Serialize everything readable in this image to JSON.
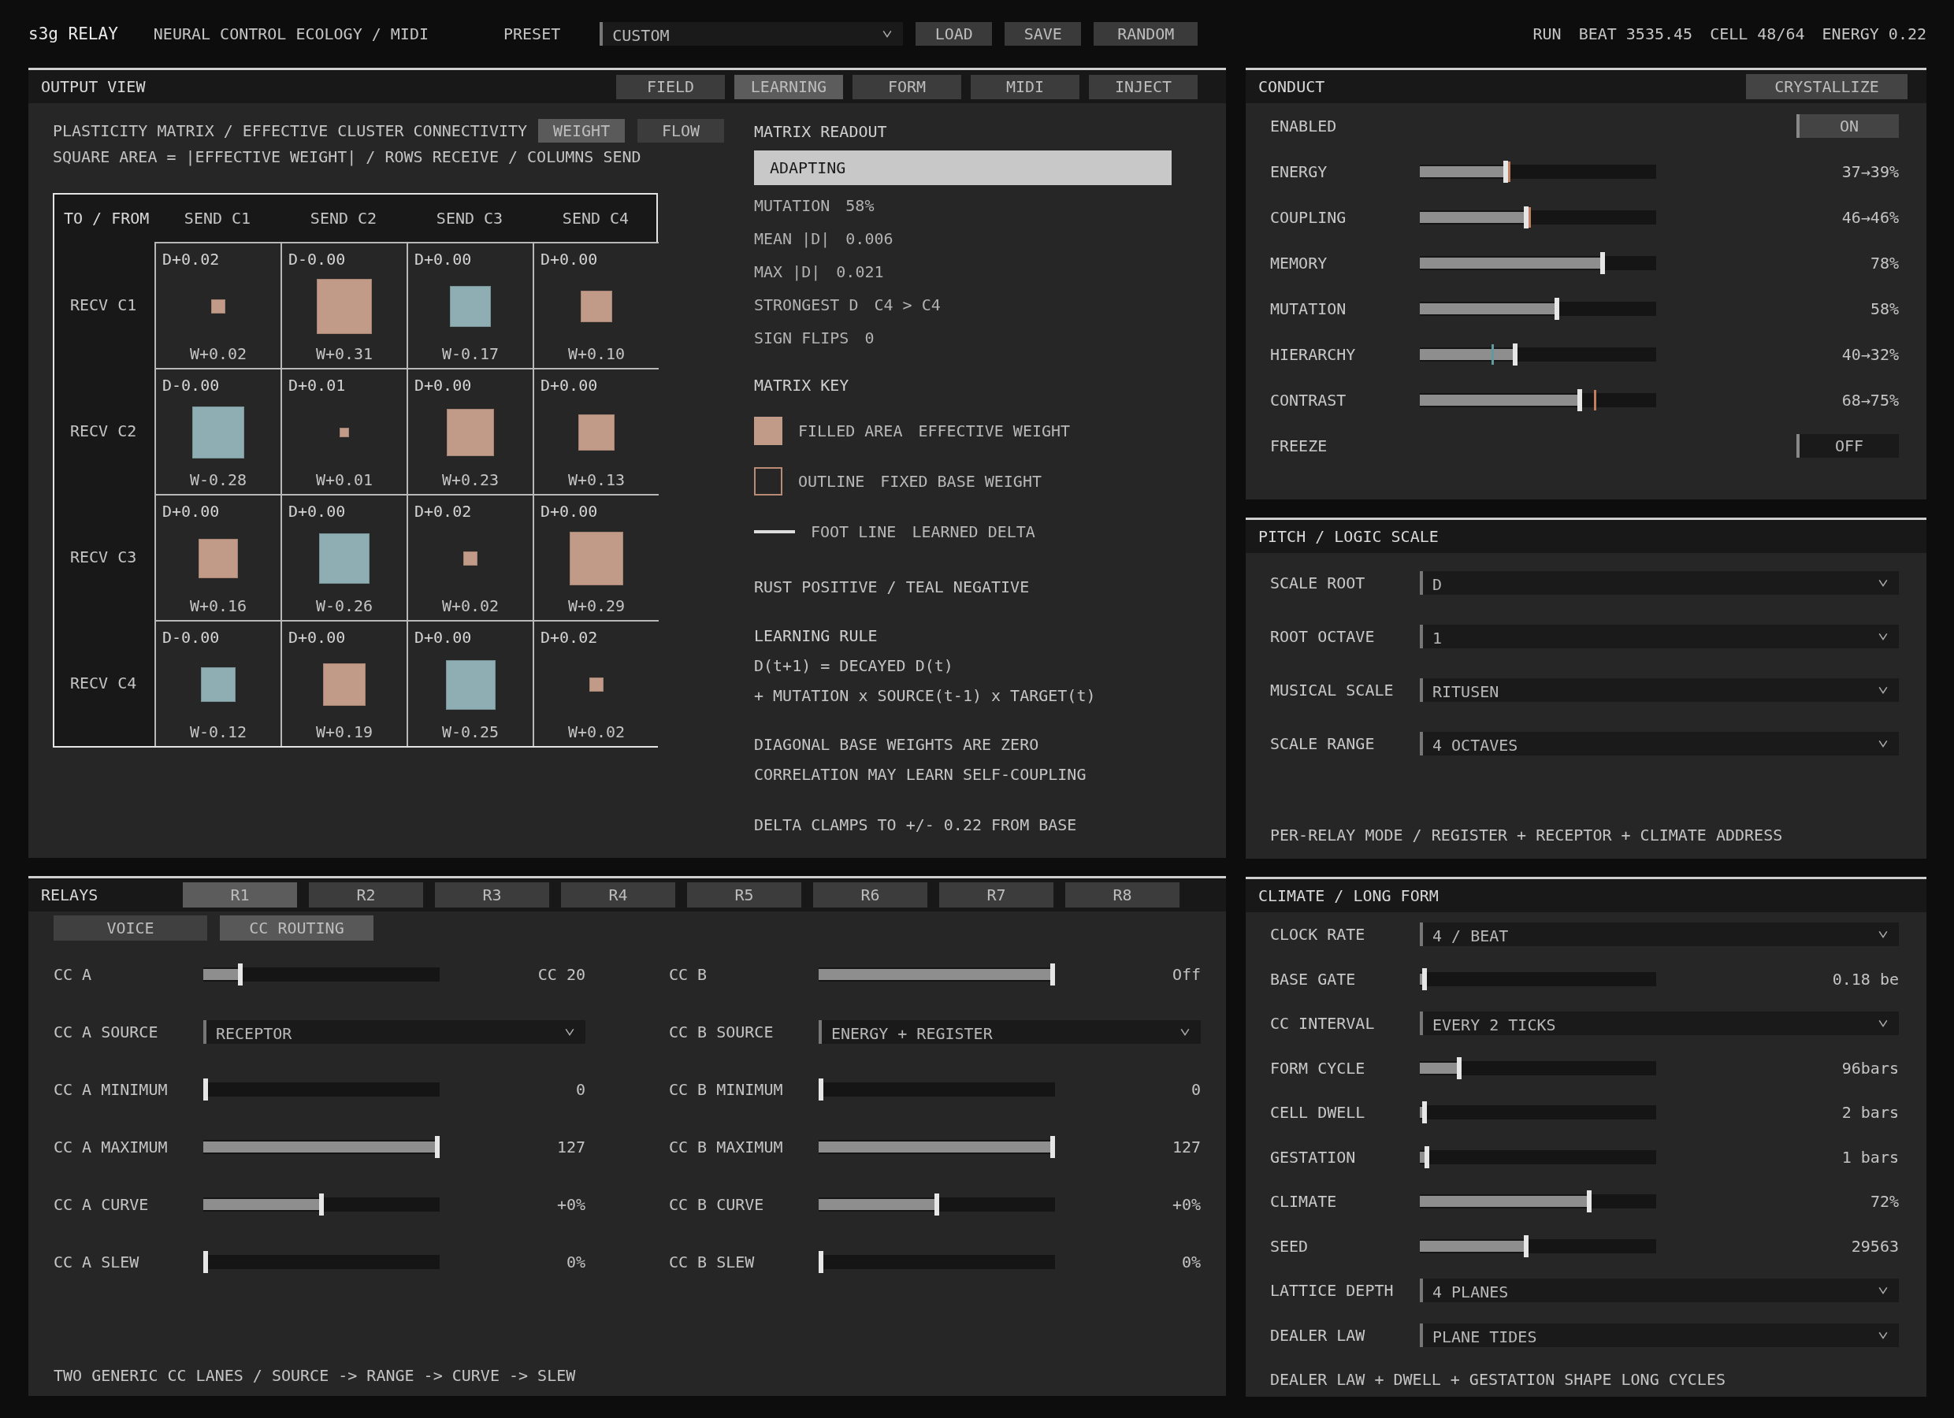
{
  "top_bar": {
    "title": "s3g RELAY",
    "subtitle": "NEURAL CONTROL ECOLOGY / MIDI",
    "preset_label": "PRESET",
    "preset": "CUSTOM",
    "buttons": [
      "LOAD",
      "SAVE",
      "RANDOM"
    ],
    "status": [
      "RUN",
      "BEAT 3535.45",
      "CELL 48/64",
      "ENERGY 0.22"
    ]
  },
  "output_view": {
    "title": "OUTPUT VIEW",
    "tabs": [
      {
        "label": "FIELD",
        "selected": false
      },
      {
        "label": "LEARNING",
        "selected": true
      },
      {
        "label": "FORM",
        "selected": false
      },
      {
        "label": "MIDI",
        "selected": false
      },
      {
        "label": "INJECT",
        "selected": false
      }
    ],
    "heading": "PLASTICITY MATRIX / EFFECTIVE CLUSTER CONNECTIVITY",
    "caption": "SQUARE AREA = |EFFECTIVE WEIGHT| / ROWS RECEIVE / COLUMNS SEND",
    "modes": [
      {
        "label": "WEIGHT",
        "selected": true
      },
      {
        "label": "FLOW",
        "selected": false
      }
    ],
    "matrix": {
      "corner": "TO / FROM",
      "columns": [
        "SEND C1",
        "SEND C2",
        "SEND C3",
        "SEND C4"
      ],
      "rows": [
        {
          "label": "RECV C1",
          "cells": [
            {
              "delta": "D+0.02",
              "weight": "W+0.02",
              "color": "#c29a88"
            },
            {
              "delta": "D-0.00",
              "weight": "W+0.31",
              "color": "#c29a88"
            },
            {
              "delta": "D+0.00",
              "weight": "W-0.17",
              "color": "#8eaeb3"
            },
            {
              "delta": "D+0.00",
              "weight": "W+0.10",
              "color": "#c29a88"
            }
          ]
        },
        {
          "label": "RECV C2",
          "cells": [
            {
              "delta": "D-0.00",
              "weight": "W-0.28",
              "color": "#8eaeb3"
            },
            {
              "delta": "D+0.01",
              "weight": "W+0.01",
              "color": "#c29a88"
            },
            {
              "delta": "D+0.00",
              "weight": "W+0.23",
              "color": "#c29a88"
            },
            {
              "delta": "D+0.00",
              "weight": "W+0.13",
              "color": "#c29a88"
            }
          ]
        },
        {
          "label": "RECV C3",
          "cells": [
            {
              "delta": "D+0.00",
              "weight": "W+0.16",
              "color": "#c29a88"
            },
            {
              "delta": "D+0.00",
              "weight": "W-0.26",
              "color": "#8eaeb3"
            },
            {
              "delta": "D+0.02",
              "weight": "W+0.02",
              "color": "#c29a88"
            },
            {
              "delta": "D+0.00",
              "weight": "W+0.29",
              "color": "#c29a88"
            }
          ]
        },
        {
          "label": "RECV C4",
          "cells": [
            {
              "delta": "D-0.00",
              "weight": "W-0.12",
              "color": "#8eaeb3"
            },
            {
              "delta": "D+0.00",
              "weight": "W+0.19",
              "color": "#c29a88"
            },
            {
              "delta": "D+0.00",
              "weight": "W-0.25",
              "color": "#8eaeb3"
            },
            {
              "delta": "D+0.02",
              "weight": "W+0.02",
              "color": "#c29a88"
            }
          ]
        }
      ]
    },
    "readout": {
      "title": "MATRIX READOUT",
      "state": "ADAPTING",
      "stats": [
        {
          "label": "MUTATION",
          "value": "58%"
        },
        {
          "label": "MEAN |D|",
          "value": "0.006"
        },
        {
          "label": "MAX |D|",
          "value": "0.021"
        },
        {
          "label": "STRONGEST D",
          "value": "C4 > C4"
        },
        {
          "label": "SIGN FLIPS",
          "value": "0"
        }
      ],
      "key_title": "MATRIX KEY",
      "key": [
        {
          "kind": "filled",
          "name": "FILLED AREA",
          "meaning": "EFFECTIVE WEIGHT"
        },
        {
          "kind": "outline",
          "name": "OUTLINE",
          "meaning": "FIXED BASE WEIGHT"
        },
        {
          "kind": "line",
          "name": "FOOT LINE",
          "meaning": "LEARNED DELTA"
        }
      ],
      "sign_note": "RUST POSITIVE / TEAL NEGATIVE",
      "rule_title": "LEARNING RULE",
      "rule": [
        "D(t+1) = DECAYED D(t)",
        "+ MUTATION x SOURCE(t-1) x TARGET(t)"
      ],
      "notes": [
        "DIAGONAL BASE WEIGHTS ARE ZERO",
        "CORRELATION MAY LEARN SELF-COUPLING"
      ],
      "clamp_note": "DELTA CLAMPS TO +/- 0.22 FROM BASE"
    }
  },
  "relays": {
    "title": "RELAYS",
    "tabs": [
      {
        "label": "R1",
        "selected": true
      },
      {
        "label": "R2",
        "selected": false
      },
      {
        "label": "R3",
        "selected": false
      },
      {
        "label": "R4",
        "selected": false
      },
      {
        "label": "R5",
        "selected": false
      },
      {
        "label": "R6",
        "selected": false
      },
      {
        "label": "R7",
        "selected": false
      },
      {
        "label": "R8",
        "selected": false
      }
    ],
    "views": [
      {
        "label": "VOICE",
        "selected": false
      },
      {
        "label": "CC ROUTING",
        "selected": true
      }
    ],
    "lanes": [
      [
        {
          "kind": "slider",
          "label": "CC A",
          "level": 0.15,
          "value": "CC 20"
        },
        {
          "kind": "select",
          "label": "CC A SOURCE",
          "value": "RECEPTOR"
        },
        {
          "kind": "slider",
          "label": "CC A MINIMUM",
          "level": 0,
          "value": "0"
        },
        {
          "kind": "slider",
          "label": "CC A MAXIMUM",
          "level": 1,
          "value": "127"
        },
        {
          "kind": "slider",
          "label": "CC A CURVE",
          "level": 0.5,
          "value": "+0%"
        },
        {
          "kind": "slider",
          "label": "CC A SLEW",
          "level": 0,
          "value": "0%"
        }
      ],
      [
        {
          "kind": "slider",
          "label": "CC B",
          "level": 1,
          "value": "Off"
        },
        {
          "kind": "select",
          "label": "CC B SOURCE",
          "value": "ENERGY + REGISTER"
        },
        {
          "kind": "slider",
          "label": "CC B MINIMUM",
          "level": 0,
          "value": "0"
        },
        {
          "kind": "slider",
          "label": "CC B MAXIMUM",
          "level": 1,
          "value": "127"
        },
        {
          "kind": "slider",
          "label": "CC B CURVE",
          "level": 0.5,
          "value": "+0%"
        },
        {
          "kind": "slider",
          "label": "CC B SLEW",
          "level": 0,
          "value": "0%"
        }
      ]
    ],
    "footer": "TWO GENERIC CC LANES / SOURCE -> RANGE -> CURVE -> SLEW"
  },
  "conduct": {
    "title": "CONDUCT",
    "action": "CRYSTALLIZE",
    "rows": [
      {
        "kind": "toggle",
        "label": "ENABLED",
        "on": true,
        "value": "ON"
      },
      {
        "kind": "slider",
        "label": "ENERGY",
        "level": 0.36,
        "target": {
          "level": 0.38,
          "color": "#c0805e"
        },
        "value": "37→39%"
      },
      {
        "kind": "slider",
        "label": "COUPLING",
        "level": 0.45,
        "target": {
          "level": 0.47,
          "color": "#c0805e"
        },
        "value": "46→46%"
      },
      {
        "kind": "slider",
        "label": "MEMORY",
        "level": 0.78,
        "value": "78%"
      },
      {
        "kind": "slider",
        "label": "MUTATION",
        "level": 0.58,
        "value": "58%"
      },
      {
        "kind": "slider",
        "label": "HIERARCHY",
        "level": 0.4,
        "target": {
          "level": 0.31,
          "color": "#5f9aa0"
        },
        "value": "40→32%"
      },
      {
        "kind": "slider",
        "label": "CONTRAST",
        "level": 0.68,
        "target": {
          "level": 0.75,
          "color": "#c0805e"
        },
        "value": "68→75%"
      },
      {
        "kind": "toggle",
        "label": "FREEZE",
        "on": false,
        "value": "OFF"
      }
    ]
  },
  "pitch": {
    "title": "PITCH / LOGIC SCALE",
    "rows": [
      {
        "label": "SCALE ROOT",
        "value": "D"
      },
      {
        "label": "ROOT OCTAVE",
        "value": "1"
      },
      {
        "label": "MUSICAL SCALE",
        "value": "RITUSEN"
      },
      {
        "label": "SCALE RANGE",
        "value": "4 OCTAVES"
      }
    ],
    "footer": "PER-RELAY MODE / REGISTER + RECEPTOR + CLIMATE ADDRESS"
  },
  "climate": {
    "title": "CLIMATE / LONG FORM",
    "rows": [
      {
        "kind": "select",
        "label": "CLOCK RATE",
        "value": "4 / BEAT"
      },
      {
        "kind": "slider",
        "label": "BASE GATE",
        "level": 0.01,
        "value": "0.18 be"
      },
      {
        "kind": "select",
        "label": "CC INTERVAL",
        "value": "EVERY 2 TICKS"
      },
      {
        "kind": "slider",
        "label": "FORM CYCLE",
        "level": 0.16,
        "value": "96bars"
      },
      {
        "kind": "slider",
        "label": "CELL DWELL",
        "level": 0.01,
        "value": "2 bars"
      },
      {
        "kind": "slider",
        "label": "GESTATION",
        "level": 0.02,
        "value": "1 bars"
      },
      {
        "kind": "slider",
        "label": "CLIMATE",
        "level": 0.72,
        "value": "72%"
      },
      {
        "kind": "slider",
        "label": "SEED",
        "level": 0.45,
        "value": "29563"
      },
      {
        "kind": "select",
        "label": "LATTICE DEPTH",
        "value": "4 PLANES"
      },
      {
        "kind": "select",
        "label": "DEALER LAW",
        "value": "PLANE TIDES"
      }
    ],
    "footer": "DEALER LAW + DWELL + GESTATION SHAPE LONG CYCLES"
  }
}
